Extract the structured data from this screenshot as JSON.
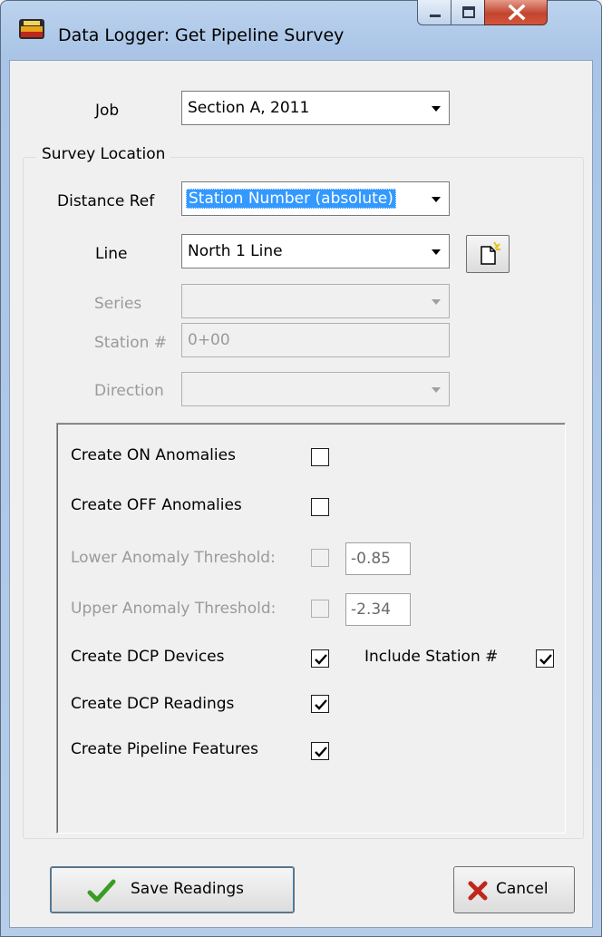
{
  "window": {
    "title": "Data Logger: Get Pipeline Survey"
  },
  "job": {
    "label": "Job",
    "value": "Section A, 2011"
  },
  "survey_location": {
    "legend": "Survey Location",
    "distance_ref": {
      "label": "Distance Ref",
      "value": "Station Number (absolute)"
    },
    "line": {
      "label": "Line",
      "value": "North 1 Line"
    },
    "series": {
      "label": "Series",
      "value": ""
    },
    "station": {
      "label": "Station #",
      "value": "0+00"
    },
    "direction": {
      "label": "Direction",
      "value": ""
    }
  },
  "options": {
    "create_on_anomalies": {
      "label": "Create ON Anomalies",
      "checked": false
    },
    "create_off_anomalies": {
      "label": "Create OFF Anomalies",
      "checked": false
    },
    "lower_threshold": {
      "label": "Lower Anomaly Threshold:",
      "checked": false,
      "value": "-0.85"
    },
    "upper_threshold": {
      "label": "Upper Anomaly Threshold:",
      "checked": false,
      "value": "-2.34"
    },
    "create_dcp_devices": {
      "label": "Create DCP Devices",
      "checked": true
    },
    "include_station": {
      "label": "Include Station #",
      "checked": true
    },
    "create_dcp_readings": {
      "label": "Create DCP Readings",
      "checked": true
    },
    "create_pipeline_features": {
      "label": "Create Pipeline Features",
      "checked": true
    }
  },
  "buttons": {
    "save": "Save Readings",
    "cancel": "Cancel"
  },
  "colors": {
    "title_bar": "#bcd3ee",
    "close_button": "#c2452f",
    "selection": "#3399ff",
    "save_check": "#3a9d23",
    "cancel_x": "#c0261b"
  },
  "icons": [
    "app-icon",
    "minimize-icon",
    "maximize-icon",
    "close-icon",
    "dropdown-arrow-icon",
    "new-document-icon",
    "checkmark-icon",
    "cancel-x-icon"
  ]
}
